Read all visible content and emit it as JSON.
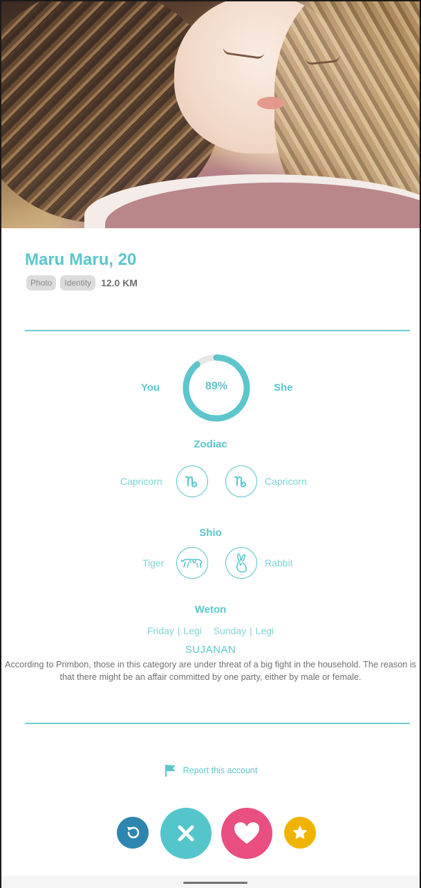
{
  "profile": {
    "name_age": "Maru Maru, 20",
    "badges": [
      "Photo",
      "Identity"
    ],
    "distance": "12.0 KM"
  },
  "compatibility": {
    "left_label": "You",
    "right_label": "She",
    "percent_text": "89%",
    "percent_value": 89
  },
  "zodiac": {
    "title": "Zodiac",
    "you": "Capricorn",
    "she": "Capricorn",
    "you_icon": "capricorn-icon",
    "she_icon": "capricorn-icon"
  },
  "shio": {
    "title": "Shio",
    "you": "Tiger",
    "she": "Rabbit",
    "you_icon": "tiger-icon",
    "she_icon": "rabbit-icon"
  },
  "weton": {
    "title": "Weton",
    "you": "Friday | Legi",
    "she": "Sunday | Legi",
    "verdict": "SUJANAN",
    "description": "According to Primbon, those in this category are under threat of a big fight in the household. The reason is that there might be an affair committed by one party, either by male or female."
  },
  "report": {
    "label": "Report this account",
    "icon": "flag-icon"
  },
  "actions": [
    {
      "name": "undo",
      "icon": "undo-icon",
      "color": "#2e86b0"
    },
    {
      "name": "nope",
      "icon": "close-icon",
      "color": "#54c6cb"
    },
    {
      "name": "like",
      "icon": "heart-icon",
      "color": "#ea4f82"
    },
    {
      "name": "super-like",
      "icon": "star-icon",
      "color": "#f0b400"
    }
  ],
  "colors": {
    "accent": "#5cc6cc",
    "ring_track": "#e6e6e6",
    "text_muted": "#6f6f6f"
  }
}
